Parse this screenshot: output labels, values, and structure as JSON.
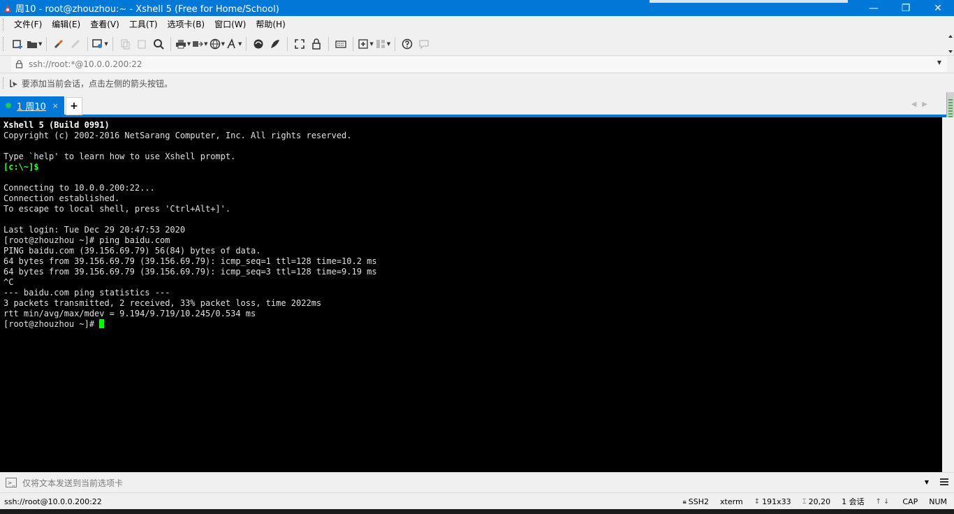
{
  "window": {
    "title": "周10 - root@zhouzhou:~ - Xshell 5 (Free for Home/School)",
    "controls": {
      "minimize": "—",
      "restore": "❐",
      "close": "✕"
    }
  },
  "menu": {
    "items": [
      "文件(F)",
      "编辑(E)",
      "查看(V)",
      "工具(T)",
      "选项卡(B)",
      "窗口(W)",
      "帮助(H)"
    ]
  },
  "toolbar": {
    "icons": [
      "new-session-icon",
      "open-folder-icon",
      "connect-icon",
      "disconnect-icon",
      "properties-icon",
      "copy-icon",
      "paste-icon",
      "find-icon",
      "print-icon",
      "transfer-icon",
      "globe-icon",
      "font-icon",
      "xftp-icon",
      "xmanager-icon",
      "fullscreen-icon",
      "lock-icon",
      "keyboard-icon",
      "new-tab-icon",
      "layout-icon",
      "help-icon",
      "chat-icon"
    ]
  },
  "address": {
    "value": "ssh://root:*@10.0.0.200:22"
  },
  "hint": {
    "text": "要添加当前会话，点击左侧的箭头按钮。"
  },
  "tabs": {
    "active_label": "1 周10",
    "close": "×",
    "add": "+"
  },
  "terminal": {
    "lines": [
      "Xshell 5 (Build 0991)",
      "Copyright (c) 2002-2016 NetSarang Computer, Inc. All rights reserved.",
      "",
      "Type `help' to learn how to use Xshell prompt.",
      "[c:\\~]$",
      "",
      "Connecting to 10.0.0.200:22...",
      "Connection established.",
      "To escape to local shell, press 'Ctrl+Alt+]'.",
      "",
      "Last login: Tue Dec 29 20:47:53 2020",
      "[root@zhouzhou ~]# ping baidu.com",
      "PING baidu.com (39.156.69.79) 56(84) bytes of data.",
      "64 bytes from 39.156.69.79 (39.156.69.79): icmp_seq=1 ttl=128 time=10.2 ms",
      "64 bytes from 39.156.69.79 (39.156.69.79): icmp_seq=3 ttl=128 time=9.19 ms",
      "^C",
      "--- baidu.com ping statistics ---",
      "3 packets transmitted, 2 received, 33% packet loss, time 2022ms",
      "rtt min/avg/max/mdev = 9.194/9.719/10.245/0.534 ms",
      "[root@zhouzhou ~]# "
    ],
    "colors": {
      "background": "#000000",
      "text": "#e0e0e0",
      "prompt_local": "#33ff33",
      "cursor": "#00ff00"
    }
  },
  "compose": {
    "placeholder": "仅将文本发送到当前选项卡"
  },
  "status": {
    "connection": "ssh://root@10.0.0.200:22",
    "protocol": "SSH2",
    "terminal_type": "xterm",
    "size": "191x33",
    "cursor_pos": "20,20",
    "sessions": "1 会话",
    "caps": "CAP",
    "num": "NUM"
  },
  "accent": "#0078d7"
}
